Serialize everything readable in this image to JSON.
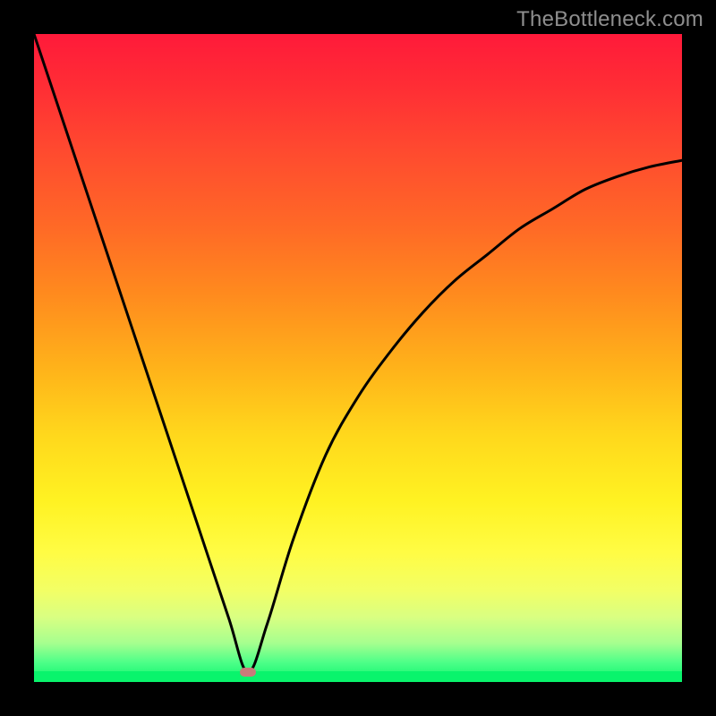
{
  "watermark": "TheBottleneck.com",
  "colors": {
    "frame": "#000000",
    "gradient_top": "#ff1a3a",
    "gradient_bottom": "#09f46c",
    "curve": "#000000",
    "marker": "#c97a7a"
  },
  "chart_data": {
    "type": "line",
    "title": "",
    "xlabel": "",
    "ylabel": "",
    "xlim": [
      0,
      100
    ],
    "ylim": [
      0,
      100
    ],
    "grid": false,
    "legend": false,
    "background": "vertical gradient red→orange→yellow→green (high=red, low=green)",
    "annotations": [
      {
        "kind": "marker",
        "x": 33,
        "y": 1.5,
        "label": "minimum"
      }
    ],
    "series": [
      {
        "name": "bottleneck-curve",
        "x": [
          0,
          5,
          10,
          15,
          20,
          25,
          30,
          33,
          36,
          40,
          45,
          50,
          55,
          60,
          65,
          70,
          75,
          80,
          85,
          90,
          95,
          100
        ],
        "values": [
          100,
          85,
          70,
          55,
          40,
          25,
          10,
          1.5,
          9,
          22,
          35,
          44,
          51,
          57,
          62,
          66,
          70,
          73,
          76,
          78,
          79.5,
          80.5
        ]
      }
    ]
  }
}
